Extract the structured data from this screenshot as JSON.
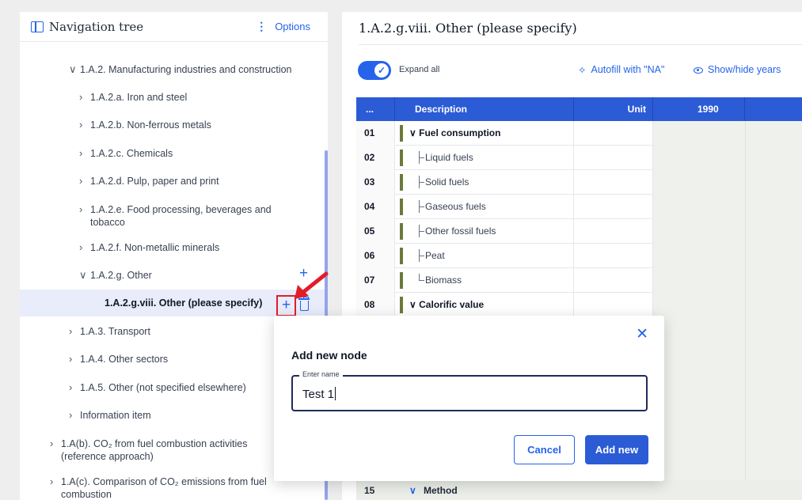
{
  "nav": {
    "title": "Navigation tree",
    "options_dots": "⋮",
    "options_label": "Options",
    "items": [
      {
        "chev": "∨",
        "label": "1.A.2. Manufacturing industries and construction"
      },
      {
        "chev": "›",
        "label": "1.A.2.a. Iron and steel"
      },
      {
        "chev": "›",
        "label": "1.A.2.b. Non-ferrous metals"
      },
      {
        "chev": "›",
        "label": "1.A.2.c. Chemicals"
      },
      {
        "chev": "›",
        "label": "1.A.2.d. Pulp, paper and print"
      },
      {
        "chev": "›",
        "label": "1.A.2.e. Food processing, beverages and tobacco"
      },
      {
        "chev": "›",
        "label": "1.A.2.f. Non-metallic minerals"
      },
      {
        "chev": "∨",
        "label": "1.A.2.g. Other",
        "plus": "+"
      },
      {
        "label": "1.A.2.g.viii. Other (please specify)",
        "plus": "+"
      },
      {
        "chev": "›",
        "label": "1.A.3. Transport"
      },
      {
        "chev": "›",
        "label": "1.A.4. Other sectors"
      },
      {
        "chev": "›",
        "label": "1.A.5. Other (not specified elsewhere)"
      },
      {
        "chev": "›",
        "label": "Information item"
      },
      {
        "chev": "›",
        "label": "1.A(b). CO₂ from fuel combustion activities (reference approach)"
      },
      {
        "chev": "›",
        "label": "1.A(c). Comparison of CO₂ emissions from fuel combustion"
      }
    ]
  },
  "main": {
    "title": "1.A.2.g.viii. Other (please specify)",
    "expand_all": "Expand all",
    "toggle_check": "✓",
    "autofill_icon": "✧",
    "autofill": "Autofill with \"NA\"",
    "show_hide": "Show/hide years",
    "grid": {
      "headers": [
        "...",
        "Description",
        "Unit",
        "1990"
      ],
      "rows": [
        {
          "num": "01",
          "label": "Fuel consumption",
          "type": "cat",
          "chev": "∨"
        },
        {
          "num": "02",
          "label": "Liquid fuels",
          "type": "sub"
        },
        {
          "num": "03",
          "label": "Solid fuels",
          "type": "sub"
        },
        {
          "num": "04",
          "label": "Gaseous fuels",
          "type": "sub"
        },
        {
          "num": "05",
          "label": "Other fossil fuels",
          "type": "sub"
        },
        {
          "num": "06",
          "label": "Peat",
          "type": "sub"
        },
        {
          "num": "07",
          "label": "Biomass",
          "type": "sub-last"
        },
        {
          "num": "08",
          "label": "Calorific value",
          "type": "cat",
          "chev": "∨"
        }
      ],
      "method_row": {
        "num": "15",
        "chev": "∨",
        "label": "Method"
      }
    }
  },
  "modal": {
    "close": "✕",
    "title": "Add new node",
    "field_label": "Enter name",
    "field_value": "Test 1",
    "cancel": "Cancel",
    "add": "Add new"
  },
  "colors": {
    "accent": "#2563eb",
    "header": "#2c5bd6",
    "highlight": "#e11d2a"
  }
}
